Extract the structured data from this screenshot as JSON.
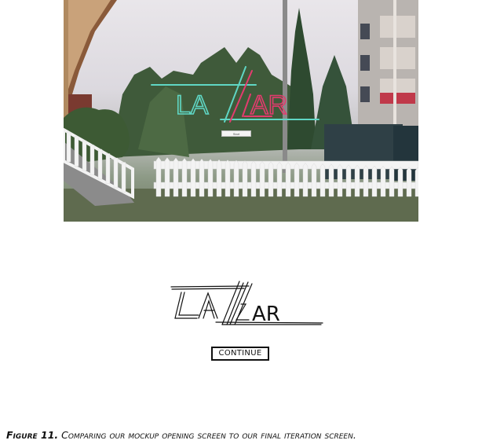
{
  "final_screen": {
    "logo_text_left": "LA",
    "logo_text_right": "AR",
    "start_button_label": "Start"
  },
  "mockup_screen": {
    "logo_text_left": "LA",
    "logo_text_right": "AR",
    "continue_button_label": "CONTINUE"
  },
  "caption": {
    "label": "Figure 11.",
    "text": "Comparing our mockup opening screen to our final iteration screen."
  },
  "colors": {
    "neon_teal": "#5fd6c4",
    "neon_pink": "#e43b6e",
    "sky": "#e9e6ea",
    "fence": "#f3f3f3"
  }
}
